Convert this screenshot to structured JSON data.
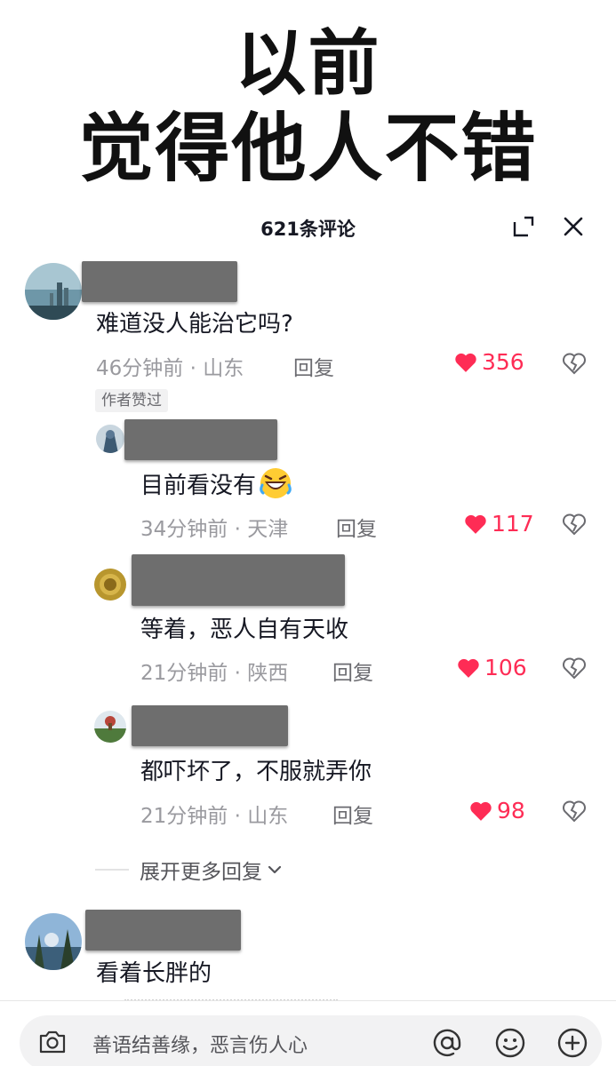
{
  "headline": {
    "line1": "以前",
    "line2": "觉得他人不错"
  },
  "sheet": {
    "title": "621条评论"
  },
  "comments": [
    {
      "text": "难道没人能治它吗?",
      "time": "46分钟前",
      "location": "山东",
      "reply": "回复",
      "likes": "356",
      "badge": "作者赞过"
    },
    {
      "text": "看着长胖的"
    }
  ],
  "replies": [
    {
      "text": "目前看没有",
      "emoji": "rolling-on-floor-laughing-emoji",
      "time": "34分钟前",
      "location": "天津",
      "reply": "回复",
      "likes": "117"
    },
    {
      "text": "等着，恶人自有天收",
      "time": "21分钟前",
      "location": "陕西",
      "reply": "回复",
      "likes": "106"
    },
    {
      "text": "都吓坏了，不服就弄你",
      "time": "21分钟前",
      "location": "山东",
      "reply": "回复",
      "likes": "98"
    }
  ],
  "expand_more": {
    "label": "展开更多回复"
  },
  "input_bar": {
    "placeholder": "善语结善缘，恶言伤人心"
  },
  "separator": " · ",
  "colors": {
    "like_red": "#fe2c55",
    "name_redaction": "#6e6e6e",
    "text": "#161823",
    "meta": "#9a9a9f"
  }
}
